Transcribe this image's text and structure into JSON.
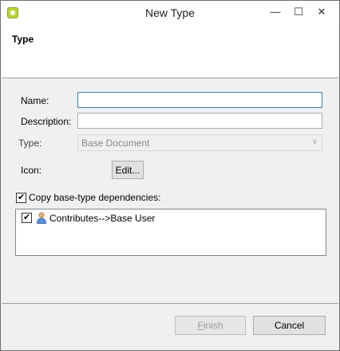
{
  "window": {
    "title": "New Type",
    "controls": {
      "minimize": "—",
      "maximize": "☐",
      "close": "✕"
    }
  },
  "header": {
    "title": "Type"
  },
  "form": {
    "name_label": "Name:",
    "name_value": "",
    "description_label": "Description:",
    "description_value": "",
    "type_label": "Type:",
    "type_selected": "Base Document",
    "type_arrow": "∨",
    "icon_label": "Icon:",
    "icon_edit_label": "Edit...",
    "copy_deps_label": "Copy base-type dependencies:",
    "copy_deps_checked": true
  },
  "dependencies": [
    {
      "label": "Contributes-->Base User",
      "checked": true,
      "icon": "user-icon"
    }
  ],
  "footer": {
    "finish_prefix": "F",
    "finish_rest": "inish",
    "cancel_label": "Cancel"
  }
}
